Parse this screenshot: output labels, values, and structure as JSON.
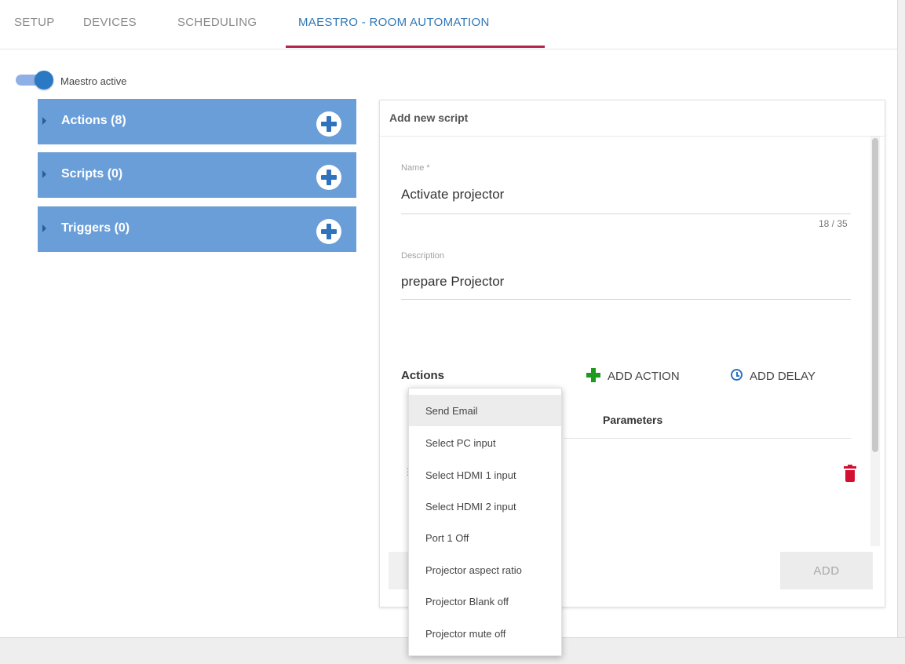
{
  "tabs": [
    {
      "label": "SETUP",
      "active": false
    },
    {
      "label": "DEVICES",
      "active": false
    },
    {
      "label": "SCHEDULING",
      "active": false
    },
    {
      "label": "MAESTRO - ROOM AUTOMATION",
      "active": true
    }
  ],
  "toggle": {
    "label": "Maestro active",
    "on": true
  },
  "panels": [
    {
      "label": "Actions (8)"
    },
    {
      "label": "Scripts (0)"
    },
    {
      "label": "Triggers (0)"
    }
  ],
  "form": {
    "title": "Add new script",
    "name_label": "Name *",
    "name_value": "Activate projector",
    "name_counter": "18 / 35",
    "description_label": "Description",
    "description_value": "prepare Projector",
    "actions_heading": "Actions",
    "add_action_label": "ADD ACTION",
    "add_delay_label": "ADD DELAY",
    "parameters_header": "Parameters",
    "add_button_label": "ADD"
  },
  "action_menu": {
    "items": [
      "Send Email",
      "Select PC input",
      "Select HDMI 1 input",
      "Select HDMI 2 input",
      "Port 1 Off",
      "Projector aspect ratio",
      "Projector Blank off",
      "Projector mute off"
    ],
    "highlighted": "Send Email"
  },
  "colors": {
    "accent_blue": "#2f78b8",
    "panel_blue": "#6a9ed8",
    "tab_underline": "#b5254c",
    "add_green": "#1e9b1e",
    "delete_red": "#d3102f"
  }
}
